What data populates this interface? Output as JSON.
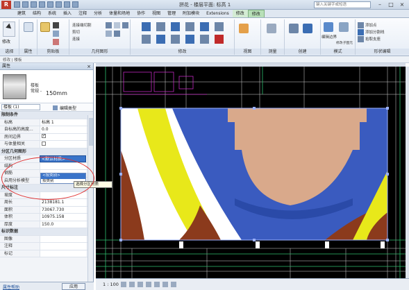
{
  "titlebar": {
    "app_letter": "R",
    "title": "拼花 - 楼层平面: 标高 1",
    "search_placeholder": "键入关键字或短语",
    "minimize": "–",
    "maximize": "□",
    "close": "×"
  },
  "tabs": [
    "建筑",
    "结构",
    "系统",
    "插入",
    "注释",
    "分析",
    "体量和场地",
    "协作",
    "视图",
    "管理",
    "附加模块",
    "Extensions",
    "修改",
    "修改"
  ],
  "ribbon": {
    "modify_label": "修改",
    "panels": {
      "select": "选择",
      "properties": "属性",
      "clipboard": "剪贴板",
      "geometry": "几何图形",
      "modify": "修改",
      "view": "视图",
      "measure": "测量",
      "create": "创建",
      "mode": "模式",
      "shape": "形状编辑"
    },
    "geometry_items": [
      "连接端切割",
      "剪切",
      "连接"
    ],
    "clipboard_items": [
      "粘贴",
      "复制"
    ],
    "shape_items": [
      "添加点",
      "添加分割线",
      "拾取支座"
    ],
    "mode_items": [
      "编辑边界",
      "修改子图元"
    ]
  },
  "properties": {
    "header": "属性",
    "type_sub": "楼板",
    "type_name": "常规 -",
    "type_thickness": "150mm",
    "filter": "楼板 (1)",
    "edit_type": "编辑类型",
    "rows": [
      {
        "group": true,
        "key": "限制条件"
      },
      {
        "key": "标高",
        "value": "标高 1"
      },
      {
        "key": "自标高的高度...",
        "value": "0.0"
      },
      {
        "key": "房间边界",
        "checkbox": true,
        "checked": true
      },
      {
        "key": "与体量相关",
        "checkbox": true,
        "checked": false
      },
      {
        "group": true,
        "key": "分区几何图形"
      },
      {
        "key": "分区材质",
        "value": "<默认材质>",
        "selected": true
      },
      {
        "key": "结构",
        "value": ""
      },
      {
        "key": "钢筋",
        "value": ""
      },
      {
        "key": "启用分析模型",
        "checkbox": true,
        "checked": false
      },
      {
        "group": true,
        "key": "尺寸标注"
      },
      {
        "key": "坡度",
        "value": ""
      },
      {
        "key": "周长",
        "value": "2138181.1"
      },
      {
        "key": "面积",
        "value": "73067.730"
      },
      {
        "key": "体积",
        "value": "10975.158"
      },
      {
        "key": "厚度",
        "value": "150.0"
      },
      {
        "group": true,
        "key": "标识数据"
      },
      {
        "key": "图像",
        "value": ""
      },
      {
        "key": "注释",
        "value": ""
      },
      {
        "key": "标记",
        "value": ""
      }
    ],
    "dropdown_options": [
      "<按类别>",
      "按类别"
    ],
    "tooltip": "选择分区材质",
    "help_link": "属性帮助",
    "apply": "应用"
  },
  "options_bar": {
    "label": "修改 | 楼板"
  },
  "status": {
    "scale": "1 : 100"
  },
  "colors": {
    "canvas_bg": "#000000",
    "blue": "#3a5bbf",
    "tan": "#d9a98b",
    "yellow": "#e8e81a",
    "brown": "#8b3a1c",
    "white": "#ffffff",
    "cad_green": "#2fbf6f",
    "cad_magenta": "#c02ac0"
  }
}
